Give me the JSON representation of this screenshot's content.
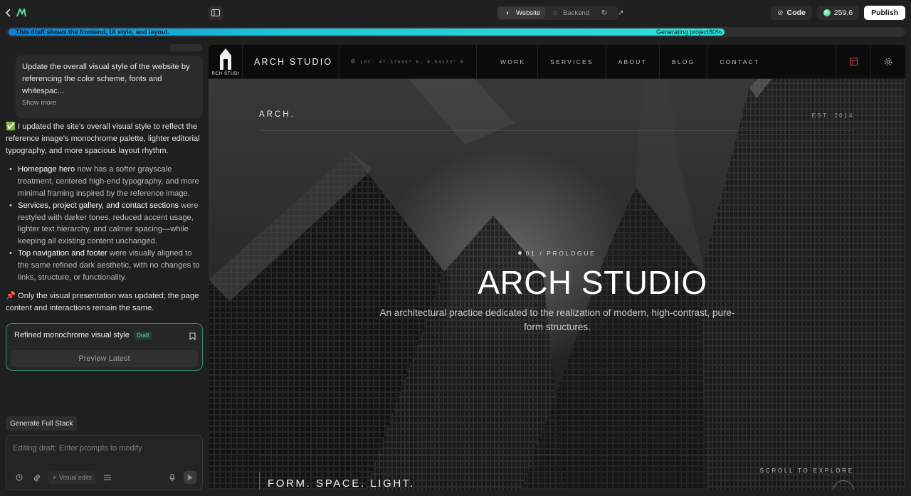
{
  "topbar": {
    "segments": [
      {
        "label": "Website",
        "active": true
      },
      {
        "label": "Backend",
        "active": false
      }
    ],
    "code_label": "Code",
    "credits": "259.6",
    "publish_label": "Publish"
  },
  "progress": {
    "message": "This draft shows the frontend, UI style, and layout.",
    "status": "Generating project80%",
    "percent": 80
  },
  "chat": {
    "user_message": "Update the overall visual style of the website by referencing the color scheme, fonts and whitespac...",
    "show_more": "Show more",
    "intro_icon": "✅",
    "intro": "I updated the site's overall visual style to reflect the reference image's monochrome palette, lighter editorial typography, and more spacious layout rhythm.",
    "bullets": [
      {
        "bold": "Homepage hero",
        "text": " now has a softer grayscale treatment, centered high-end typography, and more minimal framing inspired by the reference image."
      },
      {
        "bold": "Services, project gallery, and contact sections",
        "text": " were restyled with darker tones, reduced accent usage, lighter text hierarchy, and calmer spacing—while keeping all existing content unchanged."
      },
      {
        "bold": "Top navigation and footer",
        "text": " were visually aligned to the same refined dark aesthetic, with no changes to links, structure, or functionality."
      }
    ],
    "note_icon": "📌",
    "note": "Only the visual presentation was updated; the page content and interactions remain the same.",
    "draft_title": "Refined monochrome visual style",
    "draft_badge": "Draft",
    "preview_label": "Preview Latest",
    "generate_label": "Generate Full Stack",
    "input_placeholder": "Editing draft: Enter prompts to modify",
    "visual_edits": "Visual edits"
  },
  "site": {
    "logo_text": "RCH STUDI",
    "brand": "ARCH STUDIO",
    "loc": "LOC: 47.37695° N, 8.54173° E",
    "nav": [
      "WORK",
      "SERVICES",
      "ABOUT",
      "BLOG",
      "CONTACT"
    ],
    "hero_small": "ARCH.",
    "est": "EST. 2014",
    "prologue": "01 / PROLOGUE",
    "title": "ARCH STUDIO",
    "subtitle": "An architectural practice dedicated to the realization of modern, high-contrast, pure-form structures.",
    "footer_motto": "FORM. SPACE. LIGHT.",
    "scroll_label": "SCROLL TO EXPLORE"
  },
  "colors": {
    "accent": "#30e0d8",
    "brand_green": "#22c37a",
    "nav_icon_red": "#d8413a"
  }
}
